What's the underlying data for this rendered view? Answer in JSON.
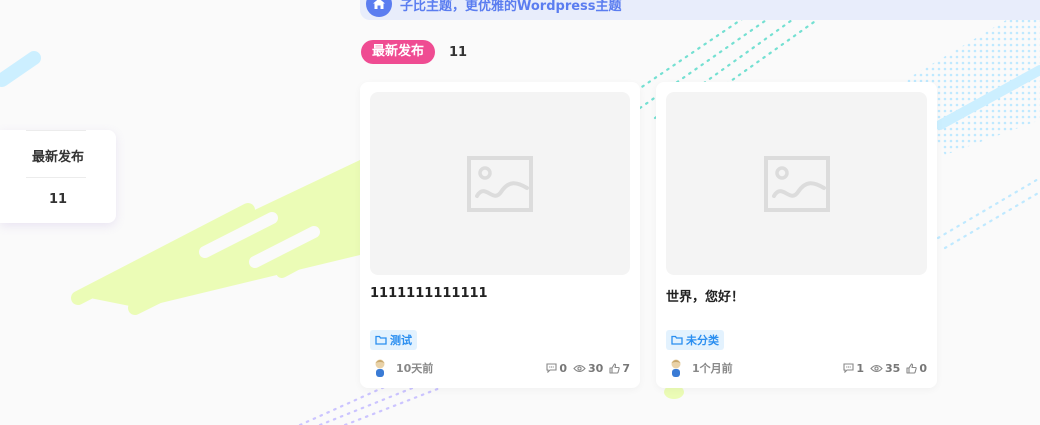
{
  "banner": {
    "text": "子比主题，更优雅的Wordpress主题"
  },
  "latest": {
    "label": "最新发布",
    "count": "11"
  },
  "sidebar": {
    "title": "最新发布",
    "count": "11"
  },
  "posts": [
    {
      "title": "1111111111111",
      "category": "测试",
      "time": "10天前",
      "comments": "0",
      "views": "30",
      "likes": "7"
    },
    {
      "title": "世界，您好！",
      "category": "未分类",
      "time": "1个月前",
      "comments": "1",
      "views": "35",
      "likes": "0"
    }
  ],
  "colors": {
    "accent_pink": "#ef4c92",
    "accent_blue": "#5b7df0",
    "tag_blue": "#2a8ef0",
    "deco_lime": "#e9fbb0",
    "deco_cyan": "#c9efff",
    "deco_teal": "#6ee0d0",
    "deco_lilac": "#c9c2ff"
  }
}
